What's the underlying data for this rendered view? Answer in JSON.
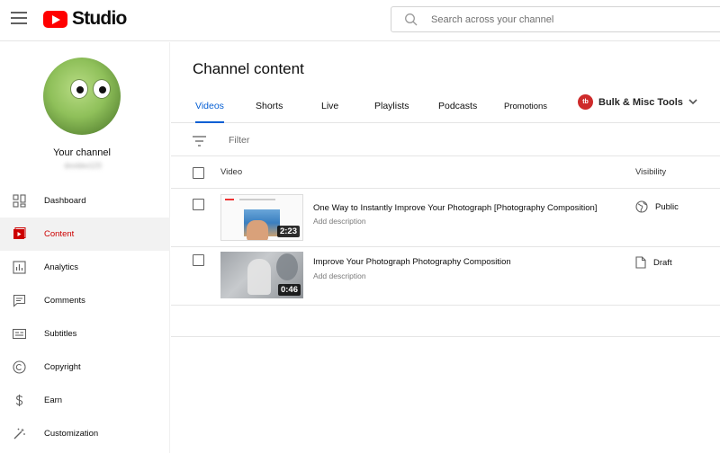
{
  "header": {
    "logo_text": "Studio",
    "search_placeholder": "Search across your channel"
  },
  "sidebar": {
    "channel_label": "Your channel",
    "channel_handle": "dovideo123",
    "items": [
      {
        "label": "Dashboard",
        "icon": "dashboard-icon"
      },
      {
        "label": "Content",
        "icon": "content-icon",
        "active": true
      },
      {
        "label": "Analytics",
        "icon": "analytics-icon"
      },
      {
        "label": "Comments",
        "icon": "comments-icon"
      },
      {
        "label": "Subtitles",
        "icon": "subtitles-icon"
      },
      {
        "label": "Copyright",
        "icon": "copyright-icon"
      },
      {
        "label": "Earn",
        "icon": "earn-icon"
      },
      {
        "label": "Customization",
        "icon": "customization-icon"
      }
    ]
  },
  "main": {
    "title": "Channel content",
    "tabs": [
      {
        "label": "Videos",
        "active": true
      },
      {
        "label": "Shorts"
      },
      {
        "label": "Live"
      },
      {
        "label": "Playlists"
      },
      {
        "label": "Podcasts"
      },
      {
        "label": "Promotions"
      }
    ],
    "bulk_tools": {
      "badge": "tb",
      "label": "Bulk & Misc Tools"
    },
    "filter_label": "Filter",
    "columns": {
      "video": "Video",
      "visibility": "Visibility"
    },
    "videos": [
      {
        "title": "One Way to Instantly Improve Your Photograph [Photography Composition]",
        "description": "Add description",
        "duration": "2:23",
        "visibility": "Public",
        "visibility_icon": "globe-icon"
      },
      {
        "title": "Improve Your Photograph Photography Composition",
        "description": "Add description",
        "duration": "0:46",
        "visibility": "Draft",
        "visibility_icon": "draft-icon"
      }
    ]
  },
  "colors": {
    "accent": "#065fd4",
    "brand_red": "#ff0000",
    "active_nav_red": "#cc0000"
  }
}
